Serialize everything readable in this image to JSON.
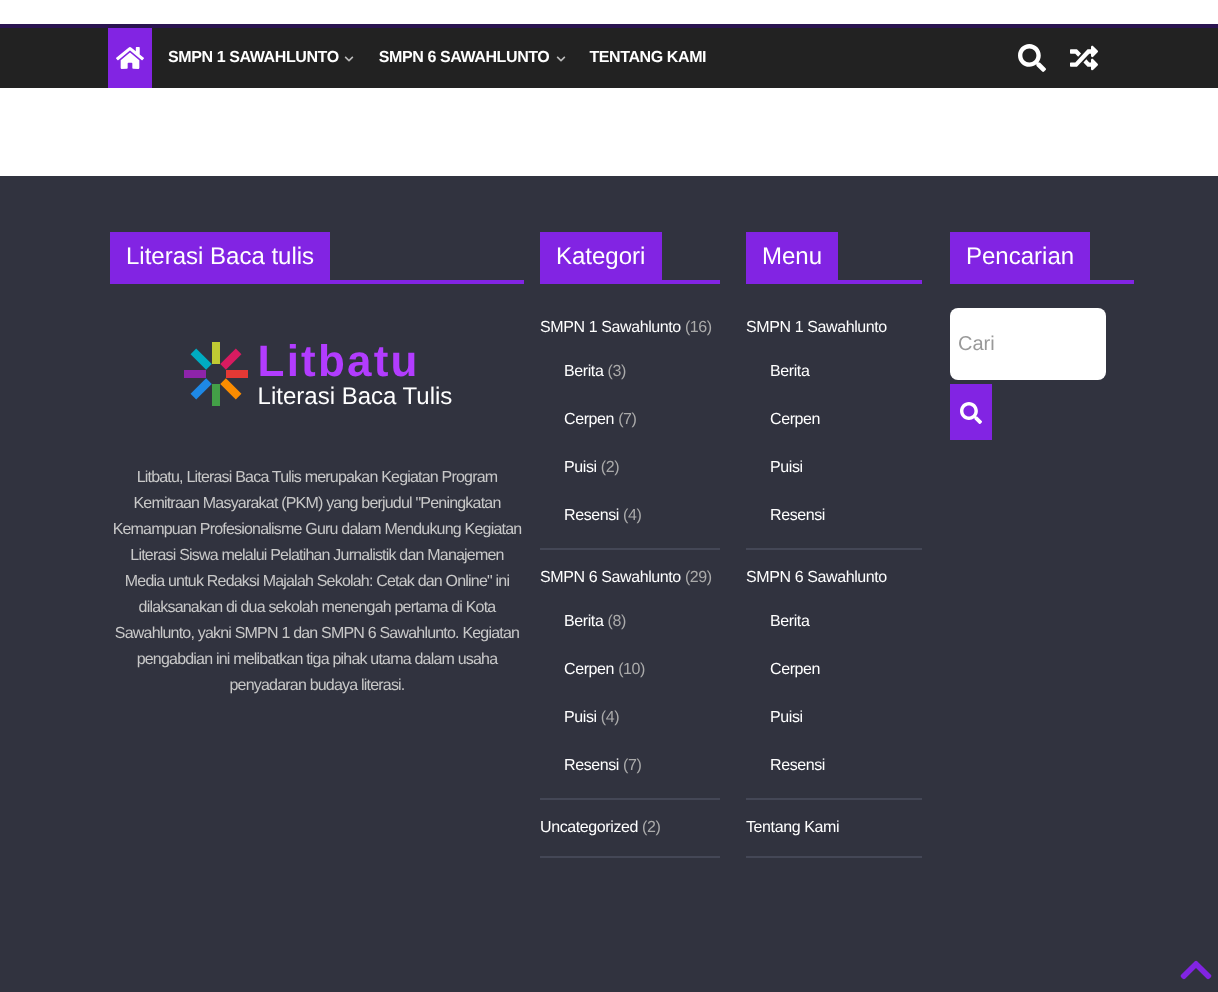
{
  "nav": {
    "items": [
      {
        "label": "SMPN 1 SAWAHLUNTO",
        "dropdown": true
      },
      {
        "label": "SMPN 6 SAWAHLUNTO",
        "dropdown": true
      },
      {
        "label": "TENTANG KAMI",
        "dropdown": false
      }
    ]
  },
  "about": {
    "title": "Literasi Baca tulis",
    "logo": {
      "name": "Litbatu",
      "tagline": "Literasi Baca Tulis"
    },
    "text": "Litbatu, Literasi Baca Tulis merupakan Kegiatan Program Kemitraan Masyarakat (PKM) yang berjudul \"Peningkatan Kemampuan Profesionalisme Guru dalam Mendukung Kegiatan Literasi Siswa melalui Pelatihan Jurnalistik dan Manajemen Media untuk Redaksi Majalah Sekolah: Cetak dan Online\" ini dilaksanakan di dua sekolah menengah pertama di Kota Sawahlunto, yakni SMPN 1 dan SMPN 6 Sawahlunto. Kegiatan pengabdian ini melibatkan tiga pihak utama dalam usaha penyadaran budaya literasi."
  },
  "kategori": {
    "title": "Kategori",
    "groups": [
      {
        "label": "SMPN 1 Sawahlunto",
        "count": "(16)",
        "children": [
          {
            "label": "Berita",
            "count": "(3)"
          },
          {
            "label": "Cerpen",
            "count": "(7)"
          },
          {
            "label": "Puisi",
            "count": "(2)"
          },
          {
            "label": "Resensi",
            "count": "(4)"
          }
        ]
      },
      {
        "label": "SMPN 6 Sawahlunto",
        "count": "(29)",
        "children": [
          {
            "label": "Berita",
            "count": "(8)"
          },
          {
            "label": "Cerpen",
            "count": "(10)"
          },
          {
            "label": "Puisi",
            "count": "(4)"
          },
          {
            "label": "Resensi",
            "count": "(7)"
          }
        ]
      },
      {
        "label": "Uncategorized",
        "count": "(2)"
      }
    ]
  },
  "menu": {
    "title": "Menu",
    "groups": [
      {
        "label": "SMPN 1 Sawahlunto",
        "children": [
          {
            "label": "Berita"
          },
          {
            "label": "Cerpen"
          },
          {
            "label": "Puisi"
          },
          {
            "label": "Resensi"
          }
        ]
      },
      {
        "label": "SMPN 6 Sawahlunto",
        "children": [
          {
            "label": "Berita"
          },
          {
            "label": "Cerpen"
          },
          {
            "label": "Puisi"
          },
          {
            "label": "Resensi"
          }
        ]
      },
      {
        "label": "Tentang Kami"
      }
    ]
  },
  "search": {
    "title": "Pencarian",
    "placeholder": "Cari"
  }
}
